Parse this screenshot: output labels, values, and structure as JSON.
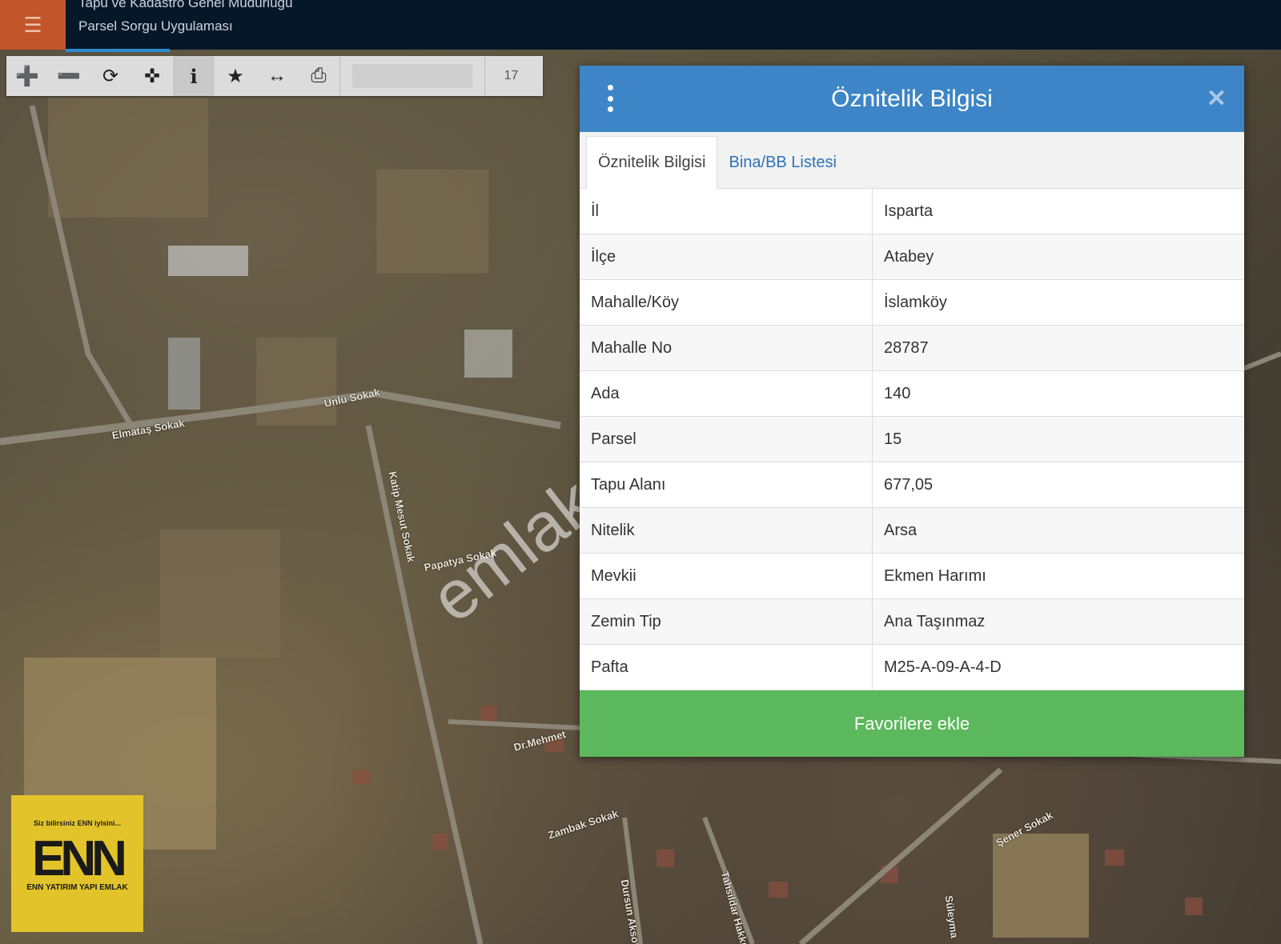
{
  "header": {
    "org": "Tapu ve Kadastro Genel Müdürlüğü",
    "app": "Parsel Sorgu Uygulaması",
    "menu_icon": "hamburger-icon"
  },
  "toolbar": {
    "tools": [
      "plus-icon",
      "minus-icon",
      "refresh-icon",
      "locate-icon",
      "info-icon",
      "star-icon",
      "measure-icon",
      "print-icon"
    ],
    "zoom": "17"
  },
  "map": {
    "streets": [
      "Ünlü Sokak",
      "Elmataş Sokak",
      "Katip Mesut Sokak",
      "Papatya Sokak",
      "Zambak Sokak",
      "Şener Sokak",
      "Dr.Mehmet",
      "Dursun Aksoy",
      "Tahsildar Hakkı",
      "Süleyma"
    ]
  },
  "panel": {
    "title": "Öznitelik Bilgisi",
    "tabs": [
      "Öznitelik Bilgisi",
      "Bina/BB Listesi"
    ],
    "rows": [
      {
        "key": "İl",
        "value": "Isparta"
      },
      {
        "key": "İlçe",
        "value": "Atabey"
      },
      {
        "key": "Mahalle/Köy",
        "value": "İslamköy"
      },
      {
        "key": "Mahalle No",
        "value": "28787"
      },
      {
        "key": "Ada",
        "value": "140"
      },
      {
        "key": "Parsel",
        "value": "15"
      },
      {
        "key": "Tapu Alanı",
        "value": "677,05"
      },
      {
        "key": "Nitelik",
        "value": "Arsa"
      },
      {
        "key": "Mevkii",
        "value": "Ekmen Harımı"
      },
      {
        "key": "Zemin Tip",
        "value": "Ana Taşınmaz"
      },
      {
        "key": "Pafta",
        "value": "M25-A-09-A-4-D"
      }
    ],
    "favorite_label": "Favorilere ekle"
  },
  "watermark": "emlak",
  "logo": {
    "tagline": "Siz bilirsiniz ENN iyisini...",
    "mark": "ENN",
    "name": "ENN YATIRIM YAPI EMLAK"
  },
  "colors": {
    "header_bg": "#07172a",
    "menu_bg": "#c2562b",
    "panel_head": "#3d85c6",
    "favorite_bg": "#5cb85c",
    "logo_bg": "#e2c42a"
  }
}
